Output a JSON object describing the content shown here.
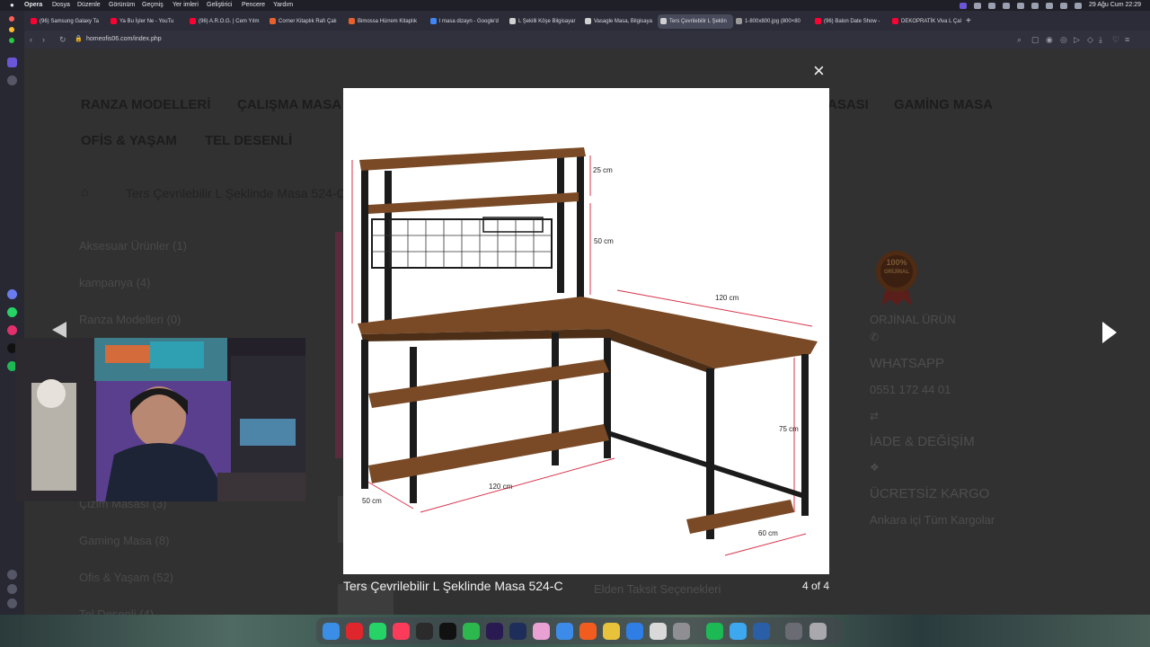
{
  "menubar": {
    "app": "Opera",
    "items": [
      "Dosya",
      "Düzenle",
      "Görünüm",
      "Geçmiş",
      "Yer imleri",
      "Geliştirici",
      "Pencere",
      "Yardım"
    ],
    "datetime": "29 Ağu Cum  22:29"
  },
  "tabs": [
    {
      "title": "(96) Samsung Galaxy Ta",
      "color": "#ff0033"
    },
    {
      "title": "Ya Bu İşler Ne - YouTu",
      "color": "#ff0033"
    },
    {
      "title": "(96) A.R.O.G. | Cem Yılm",
      "color": "#ff0033"
    },
    {
      "title": "Corner Kitaplık Rafı Çalı",
      "color": "#e8612c"
    },
    {
      "title": "Bimossa Hürrem Kitaplık",
      "color": "#e8612c"
    },
    {
      "title": "l masa dizayn - Google'd",
      "color": "#4285f4"
    },
    {
      "title": "L Şekilli Köşe Bilgisayar",
      "color": "#d0d0d0"
    },
    {
      "title": "Vasagle Masa, Bilgisaya",
      "color": "#d0d0d0"
    },
    {
      "title": "Ters Çevrilebilir L Şeklin",
      "color": "#d0d0d0"
    },
    {
      "title": "1-800x800.jpg (800×80",
      "color": "#9a9a9a"
    },
    {
      "title": "(96) Balon Date Show -",
      "color": "#ff0033"
    },
    {
      "title": "DEKOPRATİK Viva L Çal",
      "color": "#ff0033"
    }
  ],
  "active_tab_index": 8,
  "addressbar": {
    "url": "homeofis06.com/index.php"
  },
  "site": {
    "nav": [
      "RANZA MODELLERİ",
      "ÇALIŞMA MASA",
      "ASASI",
      "GAMİNG MASA",
      "OFİS & YAŞAM",
      "TEL DESENLİ"
    ],
    "breadcrumb_title": "Ters Çevrilebilir L Şeklinde Masa 524-C",
    "categories": [
      "Aksesuar Ürünler (1)",
      "kampanya (4)",
      "Ranza Modelleri (0)",
      "Çizim Masası (3)",
      "Gaming Masa (8)",
      "Ofis & Yaşam (52)",
      "Tel Desenli (4)"
    ],
    "badge": {
      "top": "100%",
      "bottom": "ORİJİNAL"
    },
    "info": {
      "original": "ORJİNAL ÜRÜN",
      "whatsapp": "WHATSAPP",
      "phone": "0551 172 44 01",
      "return": "İADE & DEĞİŞİM",
      "shipping": "ÜCRETSİZ KARGO",
      "shipping_note": "Ankara içi Tüm Kargolar"
    },
    "installments": "Elden Taksit Seçenekleri"
  },
  "lightbox": {
    "caption": "Ters Çevrilebilir L Şeklinde Masa 524-C",
    "counter": "4 of 4",
    "close": "×",
    "dimensions": {
      "top_shelf": "25 cm",
      "middle": "50 cm",
      "width_right": "120 cm",
      "height": "75 cm",
      "width_front": "120 cm",
      "depth_left": "50 cm",
      "footrest": "60 cm"
    }
  },
  "icons": [
    "apple-icon",
    "home-icon",
    "reload-icon",
    "close-icon",
    "prev-arrow-icon",
    "next-arrow-icon",
    "whatsapp-icon",
    "return-icon",
    "shipping-icon"
  ],
  "colors": {
    "overlay": "#313131",
    "nav_text": "#1c1c1c",
    "wood": "#7a4a26",
    "frame": "#1b1b1b",
    "dimension": "#d9334b"
  }
}
